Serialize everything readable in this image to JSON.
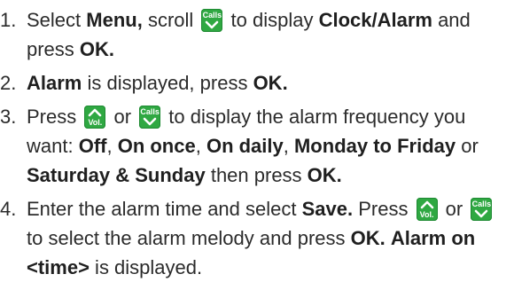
{
  "icons": {
    "calls_key_label": "Calls",
    "vol_key_label": "Vol.",
    "key_color": "#2fa842"
  },
  "steps": [
    {
      "number": "1.",
      "t1": "Select ",
      "b1": "Menu,",
      "t2": " scroll ",
      "t3": " to display ",
      "b2": "Clock/Alarm",
      "t4": " and press ",
      "b3": "OK."
    },
    {
      "number": "2.",
      "b1": "Alarm",
      "t1": " is displayed, press ",
      "b2": "OK."
    },
    {
      "number": "3.",
      "t1": "Press ",
      "t2": " or ",
      "t3": " to display the alarm frequency you want: ",
      "b1": "Off",
      "t4": ", ",
      "b2": "On once",
      "t5": ", ",
      "b3": "On daily",
      "t6": ", ",
      "b4": "Monday to Friday",
      "t7": " or ",
      "b5": "Saturday & Sunday",
      "t8": " then press ",
      "b6": "OK."
    },
    {
      "number": "4.",
      "t1": "Enter the alarm time and select ",
      "b1": "Save.",
      "t2": " Press ",
      "t3": " or ",
      "t4": " to select the alarm melody and press ",
      "b2": "OK.",
      "t5": " ",
      "b3": "Alarm on <time>",
      "t6": " is displayed."
    }
  ]
}
